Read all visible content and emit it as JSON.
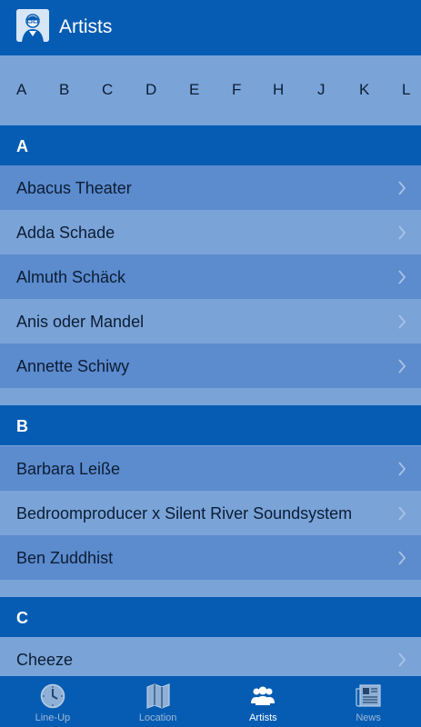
{
  "header": {
    "title": "Artists",
    "icon": "artist-avatar-icon"
  },
  "index": [
    "A",
    "B",
    "C",
    "D",
    "E",
    "F",
    "H",
    "J",
    "K",
    "L"
  ],
  "sections": [
    {
      "letter": "A",
      "items": [
        "Abacus Theater",
        "Adda Schade",
        "Almuth Schäck",
        "Anis oder Mandel",
        "Annette Schiwy"
      ]
    },
    {
      "letter": "B",
      "items": [
        "Barbara Leiße",
        "Bedroomproducer x Silent River Soundsystem",
        "Ben Zuddhist"
      ]
    },
    {
      "letter": "C",
      "items": [
        "Cheeze"
      ]
    }
  ],
  "tabs": [
    {
      "label": "Line-Up",
      "icon": "clock-icon",
      "active": false
    },
    {
      "label": "Location",
      "icon": "map-icon",
      "active": false
    },
    {
      "label": "Artists",
      "icon": "people-icon",
      "active": true
    },
    {
      "label": "News",
      "icon": "newspaper-icon",
      "active": false
    }
  ],
  "colors": {
    "primary": "#065cb3",
    "row_dark": "#5c8bce",
    "row_light": "#7aa3d8"
  }
}
